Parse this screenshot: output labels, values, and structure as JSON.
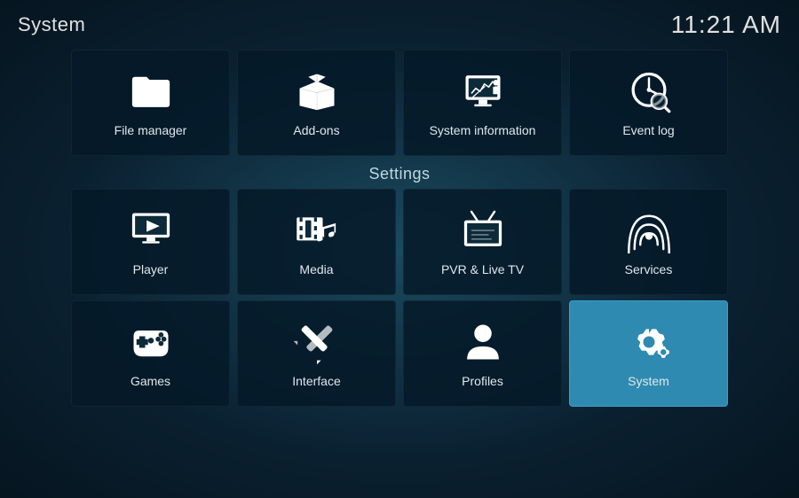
{
  "header": {
    "title": "System",
    "time": "11:21 AM"
  },
  "top_tiles": [
    {
      "id": "file-manager",
      "label": "File manager",
      "icon": "folder"
    },
    {
      "id": "add-ons",
      "label": "Add-ons",
      "icon": "addons"
    },
    {
      "id": "system-information",
      "label": "System information",
      "icon": "sysinfo"
    },
    {
      "id": "event-log",
      "label": "Event log",
      "icon": "eventlog"
    }
  ],
  "settings_label": "Settings",
  "settings_rows": [
    [
      {
        "id": "player",
        "label": "Player",
        "icon": "player"
      },
      {
        "id": "media",
        "label": "Media",
        "icon": "media"
      },
      {
        "id": "pvr-live-tv",
        "label": "PVR & Live TV",
        "icon": "pvr"
      },
      {
        "id": "services",
        "label": "Services",
        "icon": "services"
      }
    ],
    [
      {
        "id": "games",
        "label": "Games",
        "icon": "games"
      },
      {
        "id": "interface",
        "label": "Interface",
        "icon": "interface"
      },
      {
        "id": "profiles",
        "label": "Profiles",
        "icon": "profiles"
      },
      {
        "id": "system",
        "label": "System",
        "icon": "system",
        "active": true
      }
    ]
  ]
}
